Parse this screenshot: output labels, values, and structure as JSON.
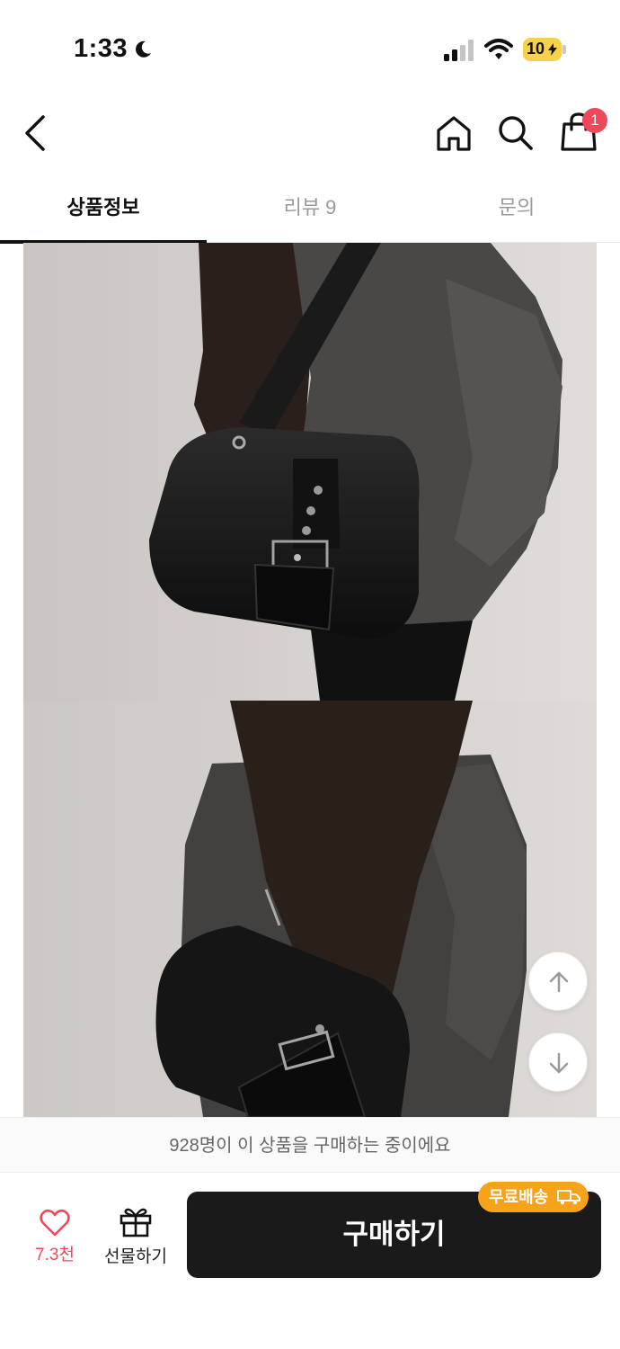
{
  "status_bar": {
    "time": "1:33",
    "battery": "10"
  },
  "header": {
    "cart_badge": "1",
    "icons": [
      "back-icon",
      "home-icon",
      "search-icon",
      "shopping-bag-icon"
    ]
  },
  "tabs": [
    {
      "label": "상품정보",
      "active": true
    },
    {
      "label": "리뷰 9",
      "active": false
    },
    {
      "label": "문의",
      "active": false
    }
  ],
  "scroll_controls": [
    "arrow-up-icon",
    "arrow-down-icon"
  ],
  "buying_banner": "928명이 이 상품을 구매하는 중이에요",
  "bottom_bar": {
    "like_count": "7.3천",
    "gift_label": "선물하기",
    "buy_label": "구매하기",
    "free_shipping_label": "무료배송"
  },
  "colors": {
    "accent_red": "#f0475a",
    "badge_orange": "#f7a21b",
    "buy_button": "#1a1a1a"
  }
}
